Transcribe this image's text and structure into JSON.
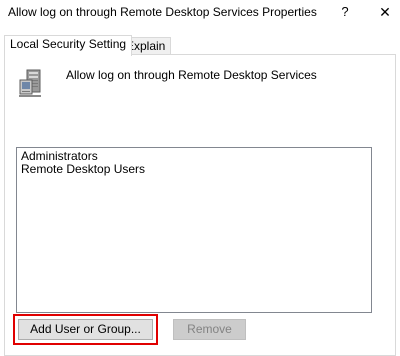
{
  "window": {
    "title": "Allow log on through Remote Desktop Services Properties",
    "help_label": "?",
    "close_label": "✕"
  },
  "tabs": [
    {
      "label": "Local Security Setting",
      "active": true
    },
    {
      "label": "Explain",
      "active": false
    }
  ],
  "policy": {
    "icon": "server-policy-icon",
    "title": "Allow log on through Remote Desktop Services"
  },
  "members": [
    "Administrators",
    "Remote Desktop Users"
  ],
  "buttons": {
    "add_label": "Add User or Group...",
    "remove_label": "Remove",
    "remove_disabled": true
  },
  "colors": {
    "highlight": "#e00000"
  }
}
